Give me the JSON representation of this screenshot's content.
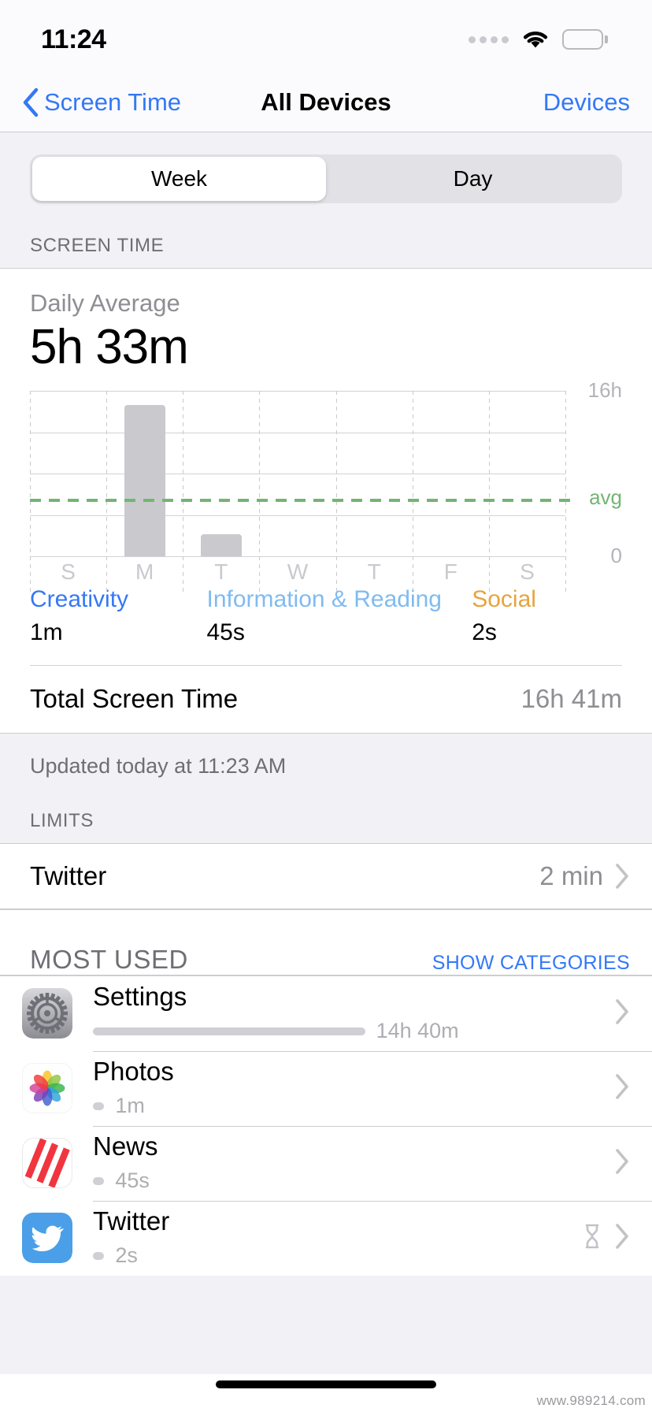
{
  "status_bar": {
    "time": "11:24",
    "signal_icon": "signal-dots-icon",
    "wifi_icon": "wifi-icon",
    "battery_icon": "battery-full-icon"
  },
  "nav": {
    "back_label": "Screen Time",
    "back_icon": "chevron-left-icon",
    "title": "All Devices",
    "right_action": "Devices"
  },
  "segmented": {
    "options": [
      "Week",
      "Day"
    ],
    "selected": "Week"
  },
  "screen_time_section": {
    "header": "SCREEN TIME",
    "daily_average_label": "Daily Average",
    "daily_average_value": "5h 33m",
    "total_label": "Total Screen Time",
    "total_value": "16h 41m",
    "updated": "Updated today at 11:23 AM",
    "categories": [
      {
        "name": "Creativity",
        "value": "1m",
        "color": "#3478f6"
      },
      {
        "name": "Information & Reading",
        "value": "45s",
        "color": "#7fbbf0"
      },
      {
        "name": "Social",
        "value": "2s",
        "color": "#e8a33d"
      }
    ]
  },
  "chart_data": {
    "type": "bar",
    "title": "Daily Average 5h 33m",
    "categories": [
      "S",
      "M",
      "T",
      "W",
      "T",
      "F",
      "S"
    ],
    "values": [
      0,
      14.6,
      2.1,
      0,
      0,
      0,
      0
    ],
    "xlabel": "",
    "ylabel": "",
    "ylim": [
      0,
      16
    ],
    "ytick_labels": [
      "16h",
      "0"
    ],
    "average_line": {
      "label": "avg",
      "value": 5.55,
      "color": "#73b573",
      "style": "dashed"
    },
    "bar_color": "#cacace",
    "grid": true,
    "legend": "none"
  },
  "limits_section": {
    "header": "LIMITS",
    "items": [
      {
        "name": "Twitter",
        "value": "2 min",
        "chevron_icon": "chevron-right-icon"
      }
    ]
  },
  "most_used": {
    "header": "MOST USED",
    "action": "SHOW CATEGORIES",
    "apps": [
      {
        "name": "Settings",
        "time": "14h 40m",
        "bar_percent": 72,
        "icon": "settings-gear-icon",
        "limited": false,
        "chevron_icon": "chevron-right-icon"
      },
      {
        "name": "Photos",
        "time": "1m",
        "bar_percent": 3,
        "icon": "photos-pinwheel-icon",
        "limited": false,
        "chevron_icon": "chevron-right-icon"
      },
      {
        "name": "News",
        "time": "45s",
        "bar_percent": 3,
        "icon": "news-icon",
        "limited": false,
        "chevron_icon": "chevron-right-icon"
      },
      {
        "name": "Twitter",
        "time": "2s",
        "bar_percent": 3,
        "icon": "twitter-bird-icon",
        "limited": true,
        "limit_icon": "hourglass-icon",
        "chevron_icon": "chevron-right-icon"
      }
    ]
  },
  "watermark": "www.989214.com"
}
